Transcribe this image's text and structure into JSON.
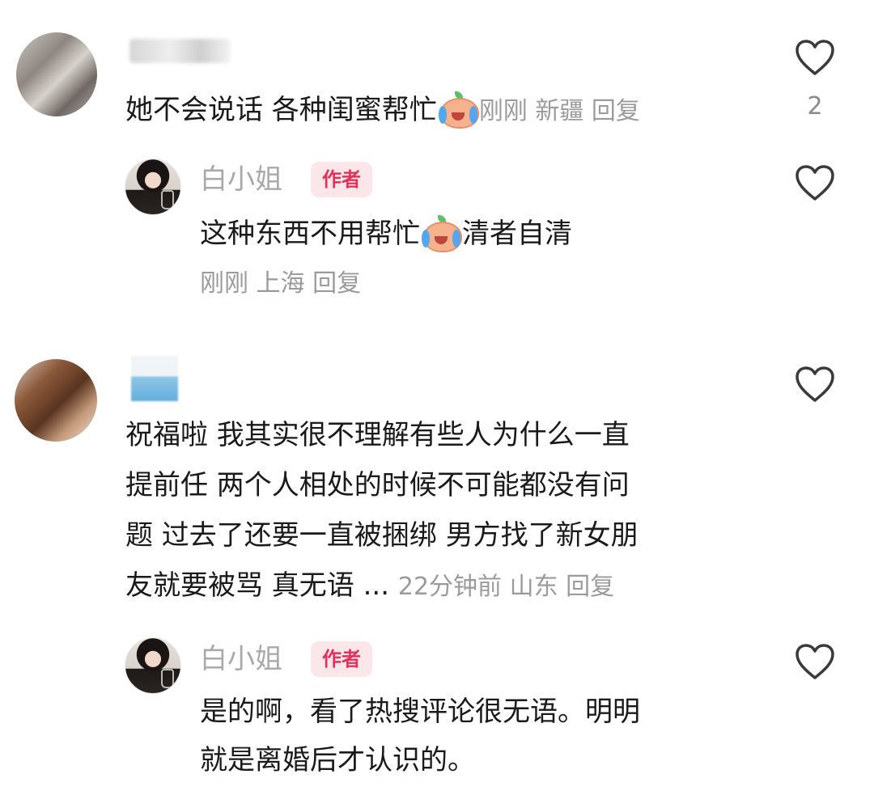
{
  "comments": [
    {
      "text": "她不会说话 各种闺蜜帮忙",
      "meta": "刚刚 新疆 回复",
      "likes": "2",
      "reply": {
        "author": "白小姐",
        "badge": "作者",
        "text_before": "这种东西不用帮忙",
        "text_after": "清者自清",
        "meta": "刚刚 上海 回复"
      }
    },
    {
      "lines": [
        "祝福啦 我其实很不理解有些人为什么一直",
        "提前任  两个人相处的时候不可能都没有问",
        "题 过去了还要一直被捆绑 男方找了新女朋",
        "友就要被骂 真无语 ..."
      ],
      "meta": "22分钟前 山东 回复",
      "reply": {
        "author": "白小姐",
        "badge": "作者",
        "lines": [
          "是的啊，看了热搜评论很无语。明明",
          "就是离婚后才认识的。"
        ]
      }
    }
  ],
  "icons": {
    "like": "heart-outline-icon",
    "emoji": "crying-peach-emoji-icon"
  },
  "colors": {
    "badge_bg": "#fbe6ea",
    "badge_text": "#e0325a",
    "meta_gray": "#9b9b9b"
  }
}
